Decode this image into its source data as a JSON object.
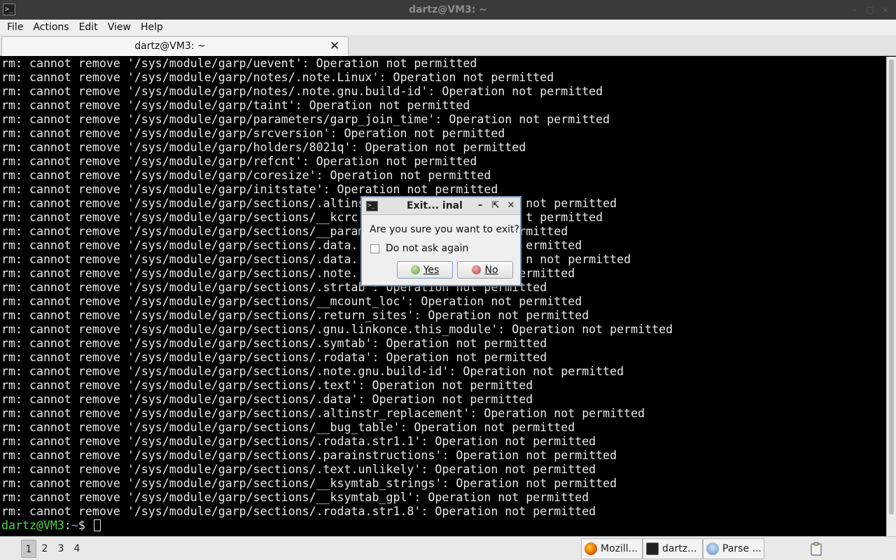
{
  "window": {
    "title": "dartz@VM3: ~",
    "app_icon": "terminal-icon"
  },
  "menubar": {
    "items": [
      "File",
      "Actions",
      "Edit",
      "View",
      "Help"
    ]
  },
  "tabs": [
    {
      "label": "dartz@VM3: ~",
      "close_icon": "close-icon"
    }
  ],
  "terminal": {
    "lines": [
      "rm: cannot remove '/sys/module/garp/uevent': Operation not permitted",
      "rm: cannot remove '/sys/module/garp/notes/.note.Linux': Operation not permitted",
      "rm: cannot remove '/sys/module/garp/notes/.note.gnu.build-id': Operation not permitted",
      "rm: cannot remove '/sys/module/garp/taint': Operation not permitted",
      "rm: cannot remove '/sys/module/garp/parameters/garp_join_time': Operation not permitted",
      "rm: cannot remove '/sys/module/garp/srcversion': Operation not permitted",
      "rm: cannot remove '/sys/module/garp/holders/8021q': Operation not permitted",
      "rm: cannot remove '/sys/module/garp/refcnt': Operation not permitted",
      "rm: cannot remove '/sys/module/garp/coresize': Operation not permitted",
      "rm: cannot remove '/sys/module/garp/initstate': Operation not permitted",
      "rm: cannot remove '/sys/module/garp/sections/.altins                       not permitted",
      "rm: cannot remove '/sys/module/garp/sections/__kcrc                        t permitted",
      "rm: cannot remove '/sys/module/garp/sections/__param                      rmitted",
      "rm: cannot remove '/sys/module/garp/sections/.data.                        ermitted",
      "rm: cannot remove '/sys/module/garp/sections/.data.                        n not permitted",
      "rm: cannot remove '/sys/module/garp/sections/.note.                       ermitted",
      "rm: cannot remove '/sys/module/garp/sections/.strtab': Operation not permitted",
      "rm: cannot remove '/sys/module/garp/sections/__mcount_loc': Operation not permitted",
      "rm: cannot remove '/sys/module/garp/sections/.return_sites': Operation not permitted",
      "rm: cannot remove '/sys/module/garp/sections/.gnu.linkonce.this_module': Operation not permitted",
      "rm: cannot remove '/sys/module/garp/sections/.symtab': Operation not permitted",
      "rm: cannot remove '/sys/module/garp/sections/.rodata': Operation not permitted",
      "rm: cannot remove '/sys/module/garp/sections/.note.gnu.build-id': Operation not permitted",
      "rm: cannot remove '/sys/module/garp/sections/.text': Operation not permitted",
      "rm: cannot remove '/sys/module/garp/sections/.data': Operation not permitted",
      "rm: cannot remove '/sys/module/garp/sections/.altinstr_replacement': Operation not permitted",
      "rm: cannot remove '/sys/module/garp/sections/__bug_table': Operation not permitted",
      "rm: cannot remove '/sys/module/garp/sections/.rodata.str1.1': Operation not permitted",
      "rm: cannot remove '/sys/module/garp/sections/.parainstructions': Operation not permitted",
      "rm: cannot remove '/sys/module/garp/sections/.text.unlikely': Operation not permitted",
      "rm: cannot remove '/sys/module/garp/sections/__ksymtab_strings': Operation not permitted",
      "rm: cannot remove '/sys/module/garp/sections/__ksymtab_gpl': Operation not permitted",
      "rm: cannot remove '/sys/module/garp/sections/.rodata.str1.8': Operation not permitted"
    ],
    "prompt_user": "dartz@VM3",
    "prompt_sep": ":",
    "prompt_path": "~",
    "prompt_symbol": "$ ",
    "colors": {
      "user": "#4ad34a",
      "path": "#6fa0ff",
      "text": "#e6e6e6",
      "background": "#000000"
    }
  },
  "dialog": {
    "title": "Exit... inal",
    "icon": "terminal-icon",
    "question": "Are you sure you want to exit?",
    "checkbox_label": "Do not ask again",
    "checkbox_checked": false,
    "yes_label": "Yes",
    "no_label": "No",
    "buttons_icons": [
      "minimize-icon",
      "maximize-icon",
      "close-icon"
    ]
  },
  "taskbar": {
    "workspaces": [
      "1",
      "2",
      "3",
      "4"
    ],
    "active_workspace": "1",
    "tasks": [
      {
        "label": "Mozill...",
        "icon": "firefox-icon"
      },
      {
        "label": "dartz...",
        "icon": "terminal-icon"
      },
      {
        "label": "Parse ...",
        "icon": "bird-icon"
      }
    ],
    "tray": {
      "icon": "clipboard-icon"
    }
  }
}
